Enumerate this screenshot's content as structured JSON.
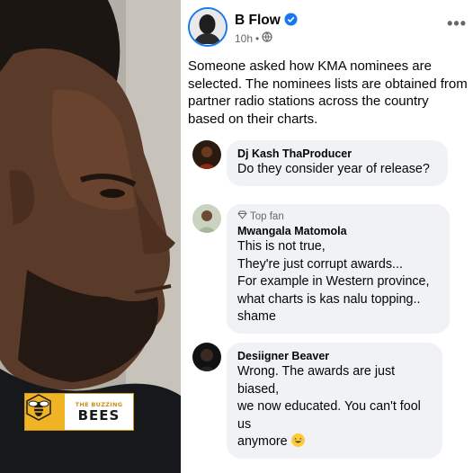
{
  "post": {
    "author": "B Flow",
    "time": "10h",
    "separator": "•",
    "text": "Someone asked how KMA nominees are selected. The nominees lists are obtained from partner radio stations across the country based on their charts."
  },
  "watermark": {
    "line1": "THE BUZZING",
    "line2": "BEES"
  },
  "comments": [
    {
      "name": "Dj Kash ThaProducer",
      "text": "Do they consider year of release?"
    },
    {
      "badge": "Top fan",
      "name": "Mwangala Matomola",
      "text": "This is not true,\nThey're just corrupt awards...\nFor example in Western province,\nwhat charts is kas nalu topping..\nshame"
    },
    {
      "name": "Desiigner Beaver",
      "text": "Wrong. The awards are just biased,\nwe now educated. You can't fool us\nanymore"
    }
  ],
  "colors": {
    "facebook_blue": "#1877f2",
    "bubble_bg": "#f0f2f5",
    "meta_gray": "#65676b",
    "watermark_gold": "#f0b323"
  },
  "icons": {
    "verified": "verified-badge-icon",
    "audience": "globe-icon",
    "more": "more-options-icon",
    "top_fan": "diamond-icon",
    "emoji": "laughing-emoji-icon"
  }
}
